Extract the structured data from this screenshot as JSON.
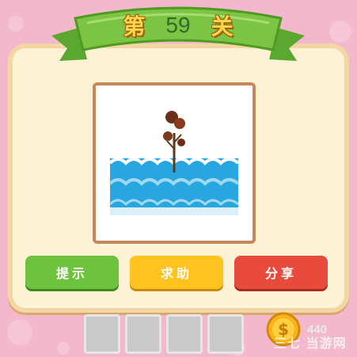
{
  "level": {
    "prefix": "第",
    "number": "59",
    "suffix": "关"
  },
  "buttons": {
    "hint": "提示",
    "help": "求助",
    "share": "分享"
  },
  "answer_slots": [
    "",
    "",
    "",
    ""
  ],
  "coins": "440",
  "watermark": "三七 当游网",
  "colors": {
    "background": "#f4b8cc",
    "ribbon": "#7cc443",
    "hint": "#6dc33b",
    "help": "#ffc21e",
    "share": "#e84a3c"
  }
}
